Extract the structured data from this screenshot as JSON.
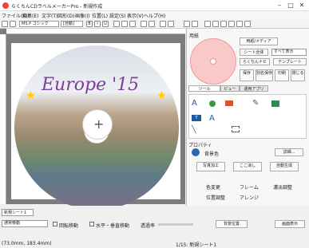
{
  "window": {
    "title": "らくちんCDラベルメーカーPro - 新規作成"
  },
  "menu": [
    "ファイル(F)",
    "編集(E)",
    "文字(T)",
    "図形(D)",
    "画像(I)",
    "位置(L)",
    "設定(S)",
    "表示(V)",
    "ヘルプ(H)"
  ],
  "toolbar": {
    "font": "MS P ゴシック",
    "size": "[自動]"
  },
  "right_panel": {
    "section_label": "用紙",
    "buttons": [
      "用紙/メディア",
      "シート全体",
      "すべて表示",
      "らくちんナビ",
      "テンプレート"
    ],
    "small_buttons": [
      "保存",
      "別名保存",
      "印刷",
      "閉じる"
    ],
    "tabs": [
      "ツール",
      "ビュー",
      "運用アプリ"
    ],
    "property_label": "プロパティ",
    "property_value": "背景色",
    "detail_button": "詳細...",
    "image_buttons": [
      "写真加工",
      "ここ消し",
      "自動生成"
    ],
    "adjust_labels": [
      "色変更",
      "フレーム",
      "濃淡調整",
      "位置調整",
      "アレンジ"
    ]
  },
  "canvas": {
    "overlay_text": "Europe '15"
  },
  "status": {
    "sheet_tab": "新規シート1",
    "mode_select": "通常移動",
    "checkbox1": "回転移動",
    "checkbox2": "水平・垂直移動",
    "slider_label": "透過率",
    "apply_btn": "背景位置",
    "coords": "(73.0mm, 183.4mm)",
    "sheet_count": "1/15: 新規シート1",
    "view_btn": "画面表示"
  }
}
